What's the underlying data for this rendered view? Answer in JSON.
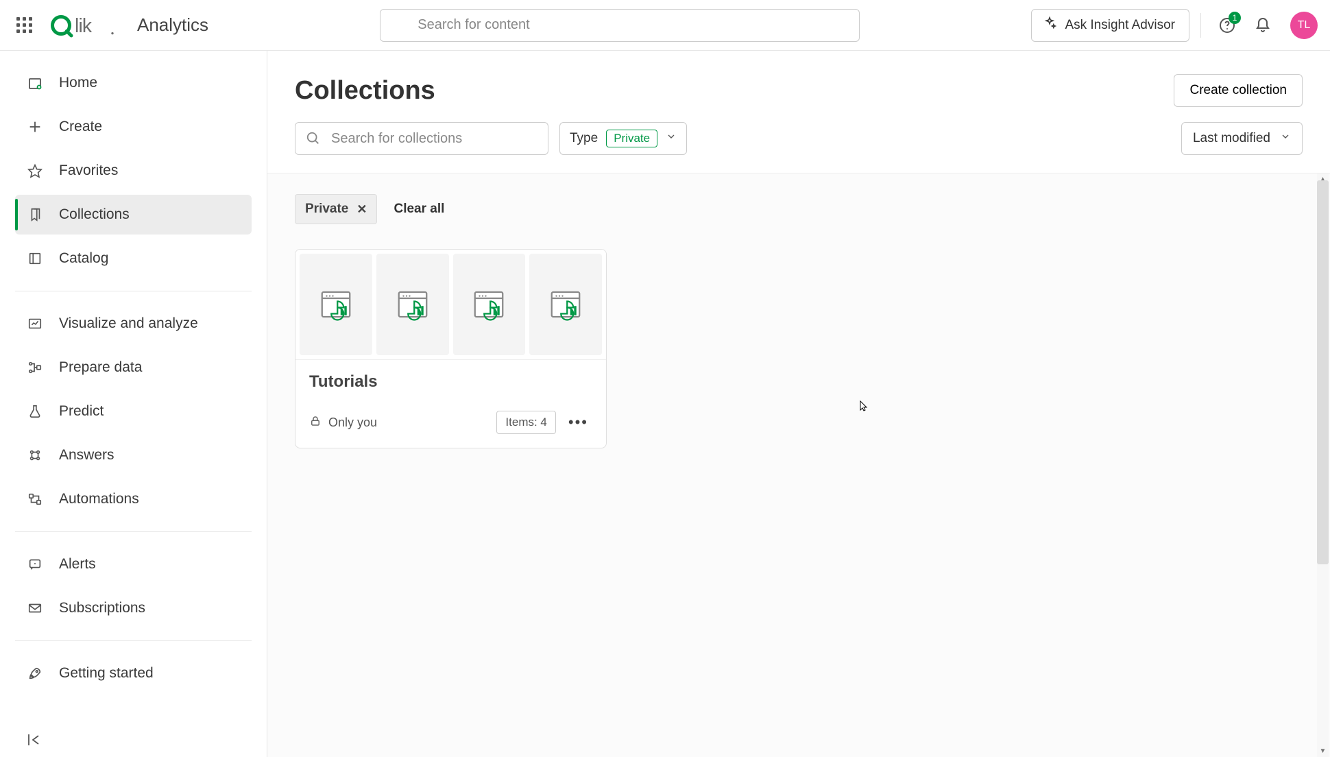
{
  "topbar": {
    "app_name": "Analytics",
    "search_placeholder": "Search for content",
    "insight_label": "Ask Insight Advisor",
    "help_badge": "1",
    "avatar_initials": "TL"
  },
  "sidebar": {
    "items": [
      {
        "label": "Home",
        "icon": "home-icon"
      },
      {
        "label": "Create",
        "icon": "plus-icon"
      },
      {
        "label": "Favorites",
        "icon": "star-icon"
      },
      {
        "label": "Collections",
        "icon": "bookmark-icon",
        "active": true
      },
      {
        "label": "Catalog",
        "icon": "catalog-icon"
      }
    ],
    "secondary": [
      {
        "label": "Visualize and analyze",
        "icon": "chart-icon"
      },
      {
        "label": "Prepare data",
        "icon": "flow-icon"
      },
      {
        "label": "Predict",
        "icon": "flask-icon"
      },
      {
        "label": "Answers",
        "icon": "answers-icon"
      },
      {
        "label": "Automations",
        "icon": "automations-icon"
      }
    ],
    "tertiary": [
      {
        "label": "Alerts",
        "icon": "alert-icon"
      },
      {
        "label": "Subscriptions",
        "icon": "mail-icon"
      }
    ],
    "bottom": [
      {
        "label": "Getting started",
        "icon": "rocket-icon"
      }
    ]
  },
  "page": {
    "title": "Collections",
    "create_button": "Create collection",
    "search_placeholder": "Search for collections",
    "type_label": "Type",
    "type_value": "Private",
    "sort_label": "Last modified"
  },
  "chips": {
    "active": "Private",
    "clear": "Clear all"
  },
  "card": {
    "title": "Tutorials",
    "visibility": "Only you",
    "items_label": "Items: 4"
  }
}
